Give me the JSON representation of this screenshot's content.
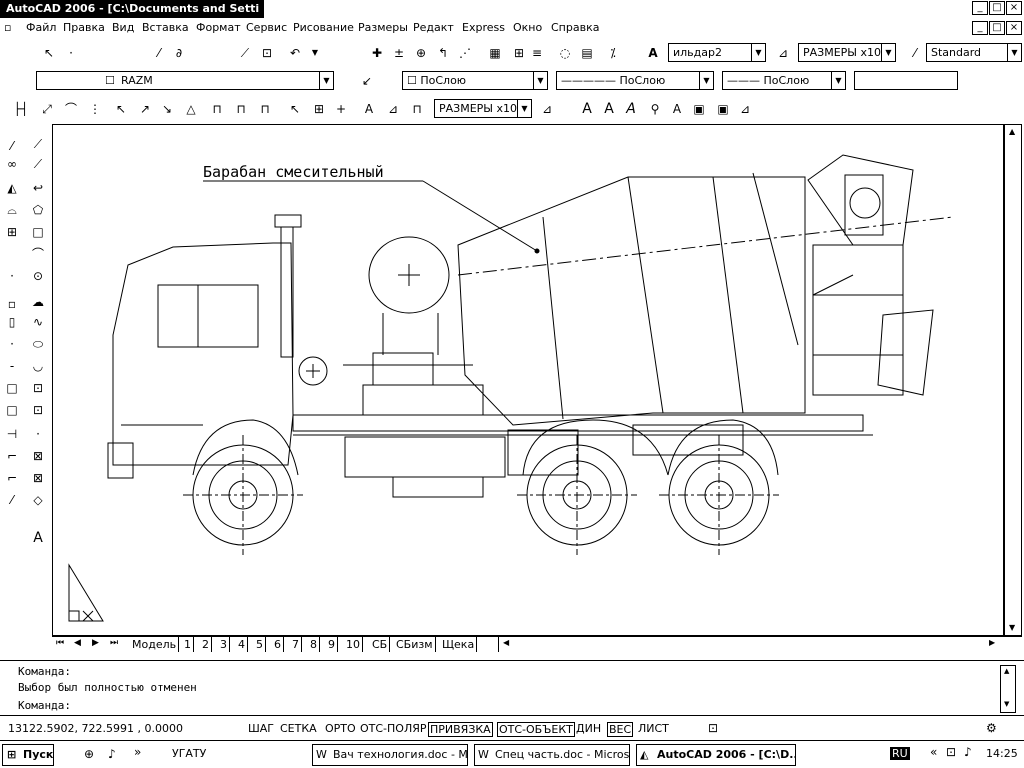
{
  "window": {
    "title": "AutoCAD 2006 - [C:\\Documents and Setti",
    "btn_min": "_",
    "btn_max": "□",
    "btn_close": "×"
  },
  "menu": [
    "Файл",
    "Правка",
    "Вид",
    "Вставка",
    "Формат",
    "Сервис",
    "Рисование",
    "Размеры",
    "Редакт",
    "Express",
    "Окно",
    "Справка"
  ],
  "toolbar1": {
    "text_style": "ильдар2",
    "dim_style": "РАЗМЕРЫ х10",
    "table_style": "Standard"
  },
  "toolbar2": {
    "layer": "RAZM",
    "color": "ПоСлою",
    "linetype": "ПоСлою",
    "lineweight": "ПоСлою"
  },
  "toolbar3": {
    "dim_style": "РАЗМЕРЫ х10"
  },
  "drawing": {
    "label": "Барабан смесительный"
  },
  "layout_tabs": [
    "Модель",
    "1",
    "2",
    "3",
    "4",
    "5",
    "6",
    "7",
    "8",
    "9",
    "10",
    "СБ",
    "СБизм",
    "Щека"
  ],
  "command_lines": [
    "Команда:",
    "Выбор был полностью отменен",
    "Команда:"
  ],
  "status": {
    "coords": "13122.5902, 722.5991 , 0.0000",
    "buttons": [
      "ШАГ",
      "СЕТКА",
      "ОРТО",
      "ОТС-ПОЛЯР",
      "ПРИВЯЗКА",
      "ОТС-ОБЪЕКТ",
      "ДИН",
      "ВЕС",
      "ЛИСТ"
    ]
  },
  "taskbar": {
    "start": "Пуск",
    "quick_label": "УГАТУ",
    "items": [
      "Вач технология.doc - M...",
      "Спец часть.doc - Micros...",
      "AutoCAD 2006 - [C:\\D..."
    ],
    "lang": "RU",
    "time": "14:25"
  }
}
